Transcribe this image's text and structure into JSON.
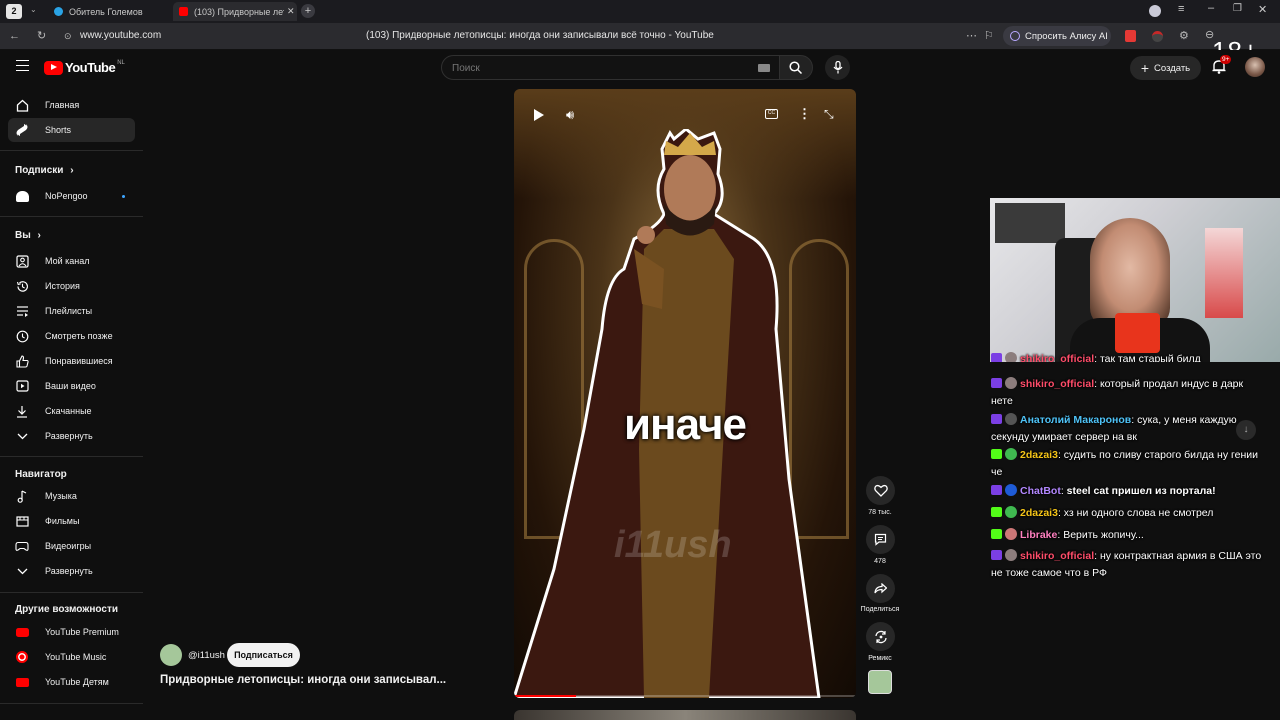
{
  "browser": {
    "tab_counter": "2",
    "tabs": [
      {
        "title": "Обитель Големов",
        "color": "#2aa3e5"
      },
      {
        "title": "(103) Придворные лето…",
        "color": "#ff0000"
      }
    ],
    "url": "www.youtube.com",
    "page_title": "(103) Придворные летописцы: иногда они записывали всё точно - YouTube",
    "ask_alice": "Спросить Алису AI",
    "age_rating": "18+"
  },
  "youtube": {
    "logo_text": "YouTube",
    "logo_region": "NL",
    "search_placeholder": "Поиск",
    "create_label": "Создать",
    "notif_count": "9+"
  },
  "sidebar": {
    "main": [
      {
        "label": "Главная",
        "icon": "home-icon"
      },
      {
        "label": "Shorts",
        "icon": "shorts-icon"
      }
    ],
    "subs_heading": "Подписки",
    "subs": [
      {
        "label": "NoPengoo"
      }
    ],
    "you_heading": "Вы",
    "you": [
      {
        "label": "Мой канал",
        "icon": "channel-icon"
      },
      {
        "label": "История",
        "icon": "history-icon"
      },
      {
        "label": "Плейлисты",
        "icon": "playlist-icon"
      },
      {
        "label": "Смотреть позже",
        "icon": "clock-icon"
      },
      {
        "label": "Понравившиеся",
        "icon": "like-icon"
      },
      {
        "label": "Ваши видео",
        "icon": "video-icon"
      },
      {
        "label": "Скачанные",
        "icon": "download-icon"
      },
      {
        "label": "Развернуть",
        "icon": "chevron-down-icon"
      }
    ],
    "nav_heading": "Навигатор",
    "nav": [
      {
        "label": "Музыка",
        "icon": "music-icon"
      },
      {
        "label": "Фильмы",
        "icon": "film-icon"
      },
      {
        "label": "Видеоигры",
        "icon": "gamepad-icon"
      },
      {
        "label": "Развернуть",
        "icon": "chevron-down-icon"
      }
    ],
    "other_heading": "Другие возможности",
    "other": [
      {
        "label": "YouTube Premium"
      },
      {
        "label": "YouTube Music"
      },
      {
        "label": "YouTube Детям"
      }
    ]
  },
  "short": {
    "caption": "иначе",
    "watermark": "i11ush",
    "channel": "@i11ush",
    "subscribe": "Подписаться",
    "title": "Придворные летописцы: иногда они записывал...",
    "likes": "78 тыс.",
    "comments": "478",
    "share": "Поделиться",
    "remix": "Ремикс"
  },
  "chat": [
    {
      "badge": "live",
      "user": "shikiro_official",
      "color": "#ff4d6a",
      "text": "так там старый билд"
    },
    {
      "badge": "live",
      "user": "shikiro_official",
      "color": "#ff4d6a",
      "text": "который продал индус в дарк нете"
    },
    {
      "badge": "live",
      "user": "Анатолий Макаронов",
      "color": "#4fc3f7",
      "text": "сука, у меня каждую секунду умирает сервер на вк"
    },
    {
      "badge": "k",
      "user": "2dazai3",
      "color": "#f5c518",
      "text": "судить по сливу старого билда ну гении че"
    },
    {
      "badge": "live",
      "user": "ChatBot",
      "color": "#b388ff",
      "text": "steel cat пришел из портала!"
    },
    {
      "badge": "k",
      "user": "2dazai3",
      "color": "#f5c518",
      "text": "хз ни одного слова не смотрел"
    },
    {
      "badge": "k",
      "user": "Librake",
      "color": "#ff80c0",
      "text": "Верить жопичу..."
    },
    {
      "badge": "live",
      "user": "shikiro_official",
      "color": "#ff4d6a",
      "text": "ну контрактная армия в США это не тоже самое что в РФ"
    }
  ]
}
